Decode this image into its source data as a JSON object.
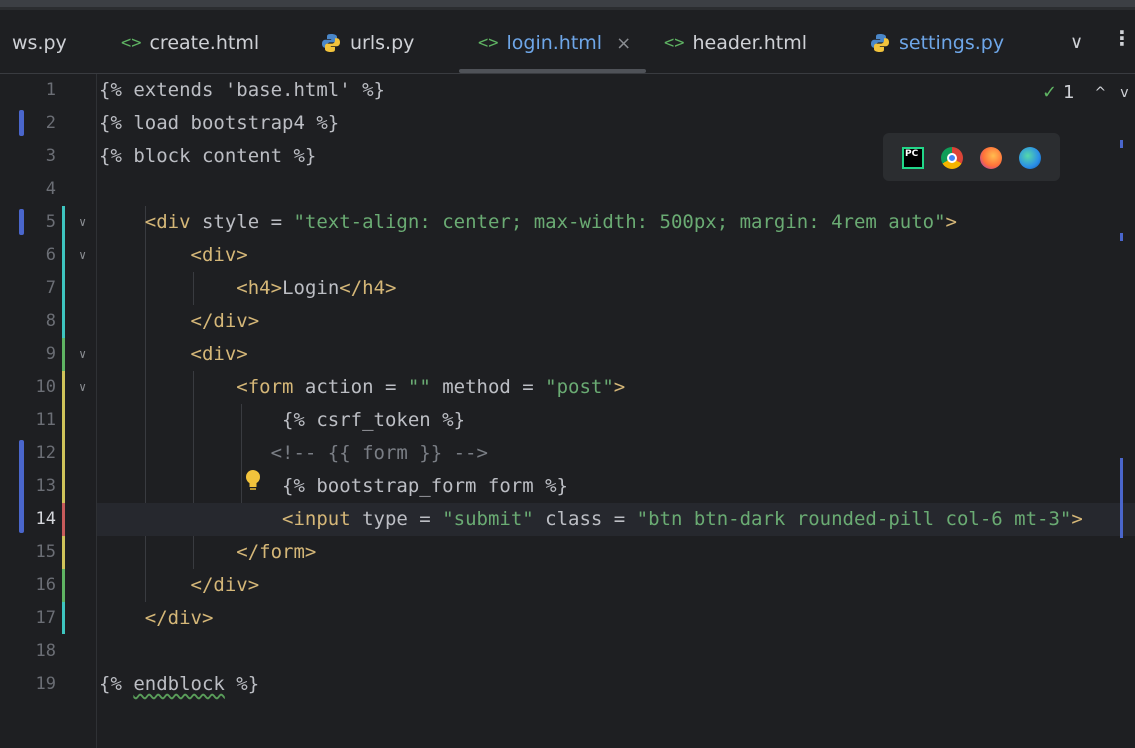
{
  "tabs": [
    {
      "label": "ws.py",
      "icon": "python-icon"
    },
    {
      "label": "create.html",
      "icon": "html-icon"
    },
    {
      "label": "urls.py",
      "icon": "python-icon"
    },
    {
      "label": "login.html",
      "icon": "html-icon",
      "active": true,
      "close": "×"
    },
    {
      "label": "header.html",
      "icon": "html-icon"
    },
    {
      "label": "settings.py",
      "icon": "python-icon"
    }
  ],
  "html_icon_glyph": "<>",
  "tabbar": {
    "chevron": "∨",
    "more": "⋮"
  },
  "inspection": {
    "count": "1",
    "check": "✓",
    "up": "^",
    "down": "v"
  },
  "browsers": [
    "pycharm-icon",
    "chrome-icon",
    "firefox-icon",
    "edge-icon"
  ],
  "pycharm_label": "PC",
  "editor": {
    "current_line": 14,
    "lines": [
      {
        "n": "1",
        "text": "{% extends 'base.html' %}"
      },
      {
        "n": "2",
        "text": "{% load bootstrap4 %}"
      },
      {
        "n": "3",
        "text": "{% block content %}"
      },
      {
        "n": "4",
        "text": ""
      },
      {
        "n": "5",
        "text": "    <div style = \"text-align: center; max-width: 500px; margin: 4rem auto\">"
      },
      {
        "n": "6",
        "text": "        <div>"
      },
      {
        "n": "7",
        "text": "            <h4>Login</h4>"
      },
      {
        "n": "8",
        "text": "        </div>"
      },
      {
        "n": "9",
        "text": "        <div>"
      },
      {
        "n": "10",
        "text": "            <form action = \"\" method = \"post\">"
      },
      {
        "n": "11",
        "text": "                {% csrf_token %}"
      },
      {
        "n": "12",
        "text": "               <!-- {{ form }} -->"
      },
      {
        "n": "13",
        "text": "                {% bootstrap_form form %}"
      },
      {
        "n": "14",
        "text": "                <input type = \"submit\" class = \"btn btn-dark rounded-pill col-6 mt-3\">"
      },
      {
        "n": "15",
        "text": "            </form>"
      },
      {
        "n": "16",
        "text": "        </div>"
      },
      {
        "n": "17",
        "text": "    </div>"
      },
      {
        "n": "18",
        "text": ""
      },
      {
        "n": "19",
        "text": "{% endblock %}"
      }
    ]
  },
  "colors": {
    "tag": "#d5b778",
    "string": "#6aab73",
    "comment": "#7a7e85",
    "text": "#bcbec4",
    "active_tab": "#6ea6e8",
    "vcs_marker": "#4a66cc"
  }
}
